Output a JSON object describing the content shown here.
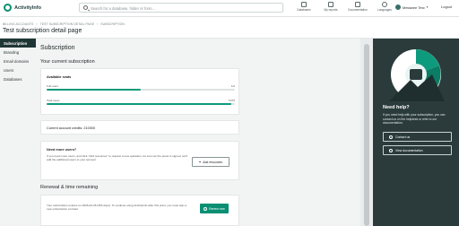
{
  "app": {
    "name": "ActivityInfo"
  },
  "search": {
    "placeholder": "Search for a database, folder or form..."
  },
  "nav": [
    {
      "label": "Databases",
      "icon": "database-icon"
    },
    {
      "label": "My reports",
      "icon": "reports-icon"
    },
    {
      "label": "Documentation",
      "icon": "documentation-icon"
    },
    {
      "label": "Languages",
      "icon": "language-icon"
    }
  ],
  "user": {
    "name": "Metawee Test",
    "logout": "Logout"
  },
  "breadcrumb": [
    "BILLING ACCOUNTS",
    "TEST SUBSCRIPTION DETAIL PAGE",
    "SUBSCRIPTION"
  ],
  "page_title": "Test subscription detail page",
  "sidebar": {
    "items": [
      {
        "label": "Subscription",
        "active": true
      },
      {
        "label": "Branding",
        "active": false
      },
      {
        "label": "Email domains",
        "active": false
      },
      {
        "label": "Users",
        "active": false
      },
      {
        "label": "Databases",
        "active": false
      }
    ]
  },
  "main": {
    "heading": "Subscription",
    "current_heading": "Your current subscription",
    "seats": {
      "title": "Available seats",
      "rows": [
        {
          "label": "Full users",
          "value": "1/2",
          "fraction": 0.5
        },
        {
          "label": "Total users",
          "value": "74/75",
          "fraction": 0.98
        }
      ]
    },
    "credits": "Current account credits: 210000",
    "need_more": {
      "title": "Need more users?",
      "description": "If you need more users, and click \"Add resources\" to request a new quotation. As soon as the quote is signed, we'll add the additional users to your account.",
      "button": "Add resources"
    },
    "renewal": {
      "heading": "Renewal & time remaining",
      "description": "Your subscription expires on 2026-02-28 (363 days). To continue using ActivityInfo after this point, you must sign a new subscription contract.",
      "button": "Renew now"
    }
  },
  "help": {
    "title": "Need help?",
    "description": "If you need help with your subscription, you can contact us on the helpdesk or refer to our documentation.",
    "buttons": [
      "Contact us",
      "View documentation"
    ]
  },
  "colors": {
    "accent": "#0a8f73",
    "panel": "#2b3b3b",
    "sidebar_active": "#1f3636"
  }
}
